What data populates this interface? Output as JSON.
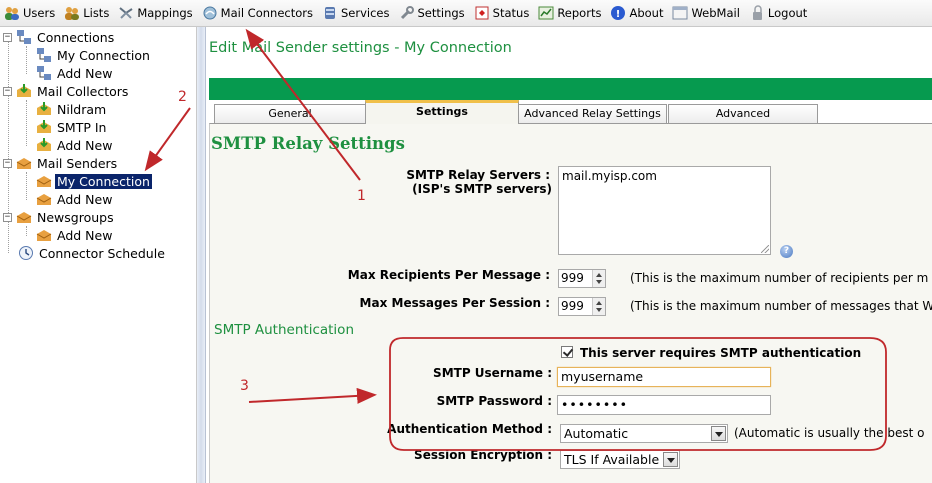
{
  "menu": [
    {
      "name": "users",
      "label": "Users",
      "icon": "users-icon"
    },
    {
      "name": "lists",
      "label": "Lists",
      "icon": "lists-icon"
    },
    {
      "name": "mappings",
      "label": "Mappings",
      "icon": "mappings-icon"
    },
    {
      "name": "mail-connectors",
      "label": "Mail Connectors",
      "icon": "mail-connectors-icon"
    },
    {
      "name": "services",
      "label": "Services",
      "icon": "services-icon"
    },
    {
      "name": "settings",
      "label": "Settings",
      "icon": "settings-icon"
    },
    {
      "name": "status",
      "label": "Status",
      "icon": "status-icon"
    },
    {
      "name": "reports",
      "label": "Reports",
      "icon": "reports-icon"
    },
    {
      "name": "about",
      "label": "About",
      "icon": "about-icon"
    },
    {
      "name": "webmail",
      "label": "WebMail",
      "icon": "webmail-icon"
    },
    {
      "name": "logout",
      "label": "Logout",
      "icon": "logout-icon"
    }
  ],
  "tree": {
    "connections": "Connections",
    "my_connection_conn": "My Connection",
    "add_new_conn": "Add New",
    "mail_collectors": "Mail Collectors",
    "nildram": "Nildram",
    "smtp_in": "SMTP In",
    "add_new_collectors": "Add New",
    "mail_senders": "Mail Senders",
    "my_connection_sender": "My Connection",
    "add_new_senders": "Add New",
    "newsgroups": "Newsgroups",
    "add_new_news": "Add New",
    "connector_schedule": "Connector Schedule"
  },
  "page": {
    "title": "Edit Mail Sender settings - My Connection",
    "tabs": [
      "General",
      "Settings",
      "Advanced Relay Settings",
      "Advanced"
    ],
    "active_tab": "Settings"
  },
  "form": {
    "section_title": "SMTP Relay Settings",
    "relay_servers_label_1": "SMTP Relay Servers :",
    "relay_servers_label_2": "(ISP's SMTP servers)",
    "relay_servers_value": "mail.myisp.com",
    "help_glyph": "?",
    "max_recipients_label": "Max Recipients Per Message :",
    "max_recipients_value": "999",
    "max_recipients_hint": "(This is the maximum number of recipients per m",
    "max_messages_label": "Max Messages Per Session :",
    "max_messages_value": "999",
    "max_messages_hint": "(This is the maximum number of messages that W",
    "auth_section": "SMTP Authentication",
    "requires_auth_label": "This server requires SMTP authentication",
    "requires_auth_checked": true,
    "username_label": "SMTP Username :",
    "username_value": "myusername",
    "password_label": "SMTP Password :",
    "password_value": "••••••••",
    "auth_method_label": "Authentication Method :",
    "auth_method_value": "Automatic",
    "auth_method_hint": "(Automatic is usually the best o",
    "encryption_label": "Session Encryption :",
    "encryption_value": "TLS If Available"
  },
  "annotations": {
    "one": "1",
    "two": "2",
    "three": "3",
    "color": "#c0282b"
  },
  "colors": {
    "accent_green": "#1e9040",
    "band_green": "#069a4f",
    "selection": "#0a246a"
  }
}
